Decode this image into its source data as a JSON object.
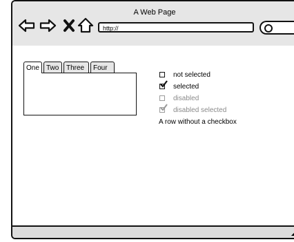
{
  "window": {
    "title": "A Web Page",
    "url": "http://",
    "icons": [
      "back-arrow-icon",
      "forward-arrow-icon",
      "close-x-icon",
      "home-icon",
      "search-icon"
    ]
  },
  "tabs": {
    "items": [
      {
        "label": "One"
      },
      {
        "label": "Two"
      },
      {
        "label": "Three"
      },
      {
        "label": "Four"
      }
    ],
    "active_index": 0
  },
  "checkboxes": {
    "rows": [
      {
        "label": "not selected",
        "checked": false,
        "disabled": false
      },
      {
        "label": "selected",
        "checked": true,
        "disabled": false
      },
      {
        "label": "disabled",
        "checked": false,
        "disabled": true
      },
      {
        "label": "disabled selected",
        "checked": true,
        "disabled": true
      }
    ],
    "plain_row": "A row without a checkbox"
  },
  "colors": {
    "chrome": "#e6e6e6",
    "stroke": "#111111",
    "disabled_text": "#8a8a8a"
  }
}
